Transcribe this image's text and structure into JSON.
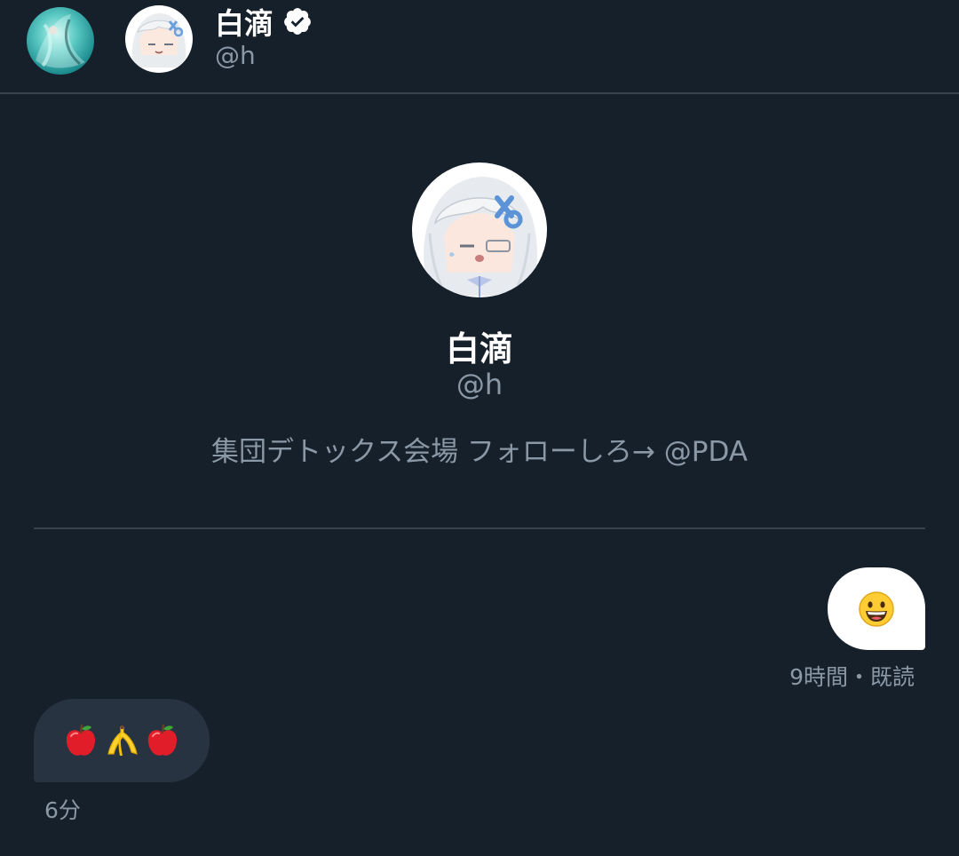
{
  "header": {
    "display_name": "白滴",
    "handle": "@h"
  },
  "profile": {
    "display_name": "白滴",
    "handle": "@h",
    "bio": "集団デトックス会場 フォローしろ→ @PDA"
  },
  "messages": [
    {
      "direction": "sent",
      "content_icons": [
        "grinning-face-emoji"
      ],
      "meta": "9時間・既読"
    },
    {
      "direction": "received",
      "content_icons": [
        "red-apple-emoji",
        "banana-emoji",
        "red-apple-emoji"
      ],
      "meta": "6分"
    }
  ],
  "colors": {
    "background": "#15202b",
    "divider": "#38444d",
    "secondary_text": "#8b98a5",
    "received_bubble": "#273340",
    "sent_bubble": "#ffffff"
  }
}
